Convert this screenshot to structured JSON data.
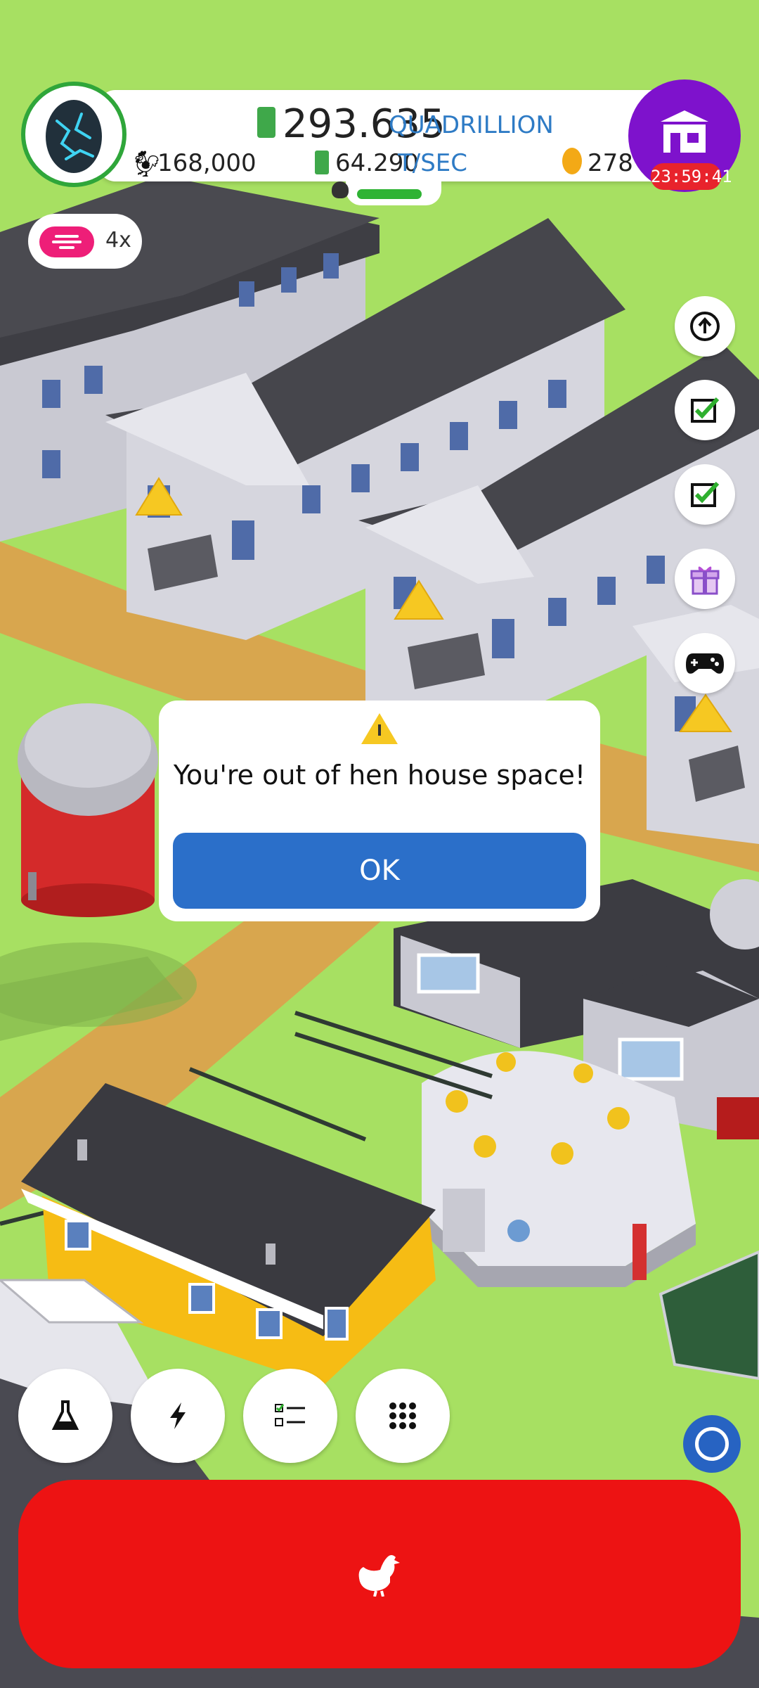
{
  "header": {
    "money": "293.635",
    "money_unit": "QUADRILLION",
    "chickens": "168,000",
    "rate": "64.290",
    "rate_unit": "T/SEC",
    "golden_eggs": "278",
    "shop_timer": "23:59:41",
    "habitat_progress_fraction": 0.85
  },
  "drone_boost": {
    "multiplier": "4x"
  },
  "side_buttons": [
    {
      "name": "upgrade-arrow-icon"
    },
    {
      "name": "mission-complete-icon"
    },
    {
      "name": "mission-complete-icon"
    },
    {
      "name": "gift-icon"
    },
    {
      "name": "gamepad-icon"
    }
  ],
  "dialog": {
    "message": "You're out of hen house space!",
    "ok_label": "OK"
  },
  "bottom_bar": [
    {
      "name": "research-flask-icon"
    },
    {
      "name": "boost-lightning-icon"
    },
    {
      "name": "checklist-icon"
    },
    {
      "name": "menu-grid-icon"
    }
  ],
  "colors": {
    "grass": "#A7E062",
    "hatch_button": "#ED1313",
    "ok_button": "#2B6FC9",
    "shop": "#7E12CC",
    "progress": "#2FB334"
  }
}
